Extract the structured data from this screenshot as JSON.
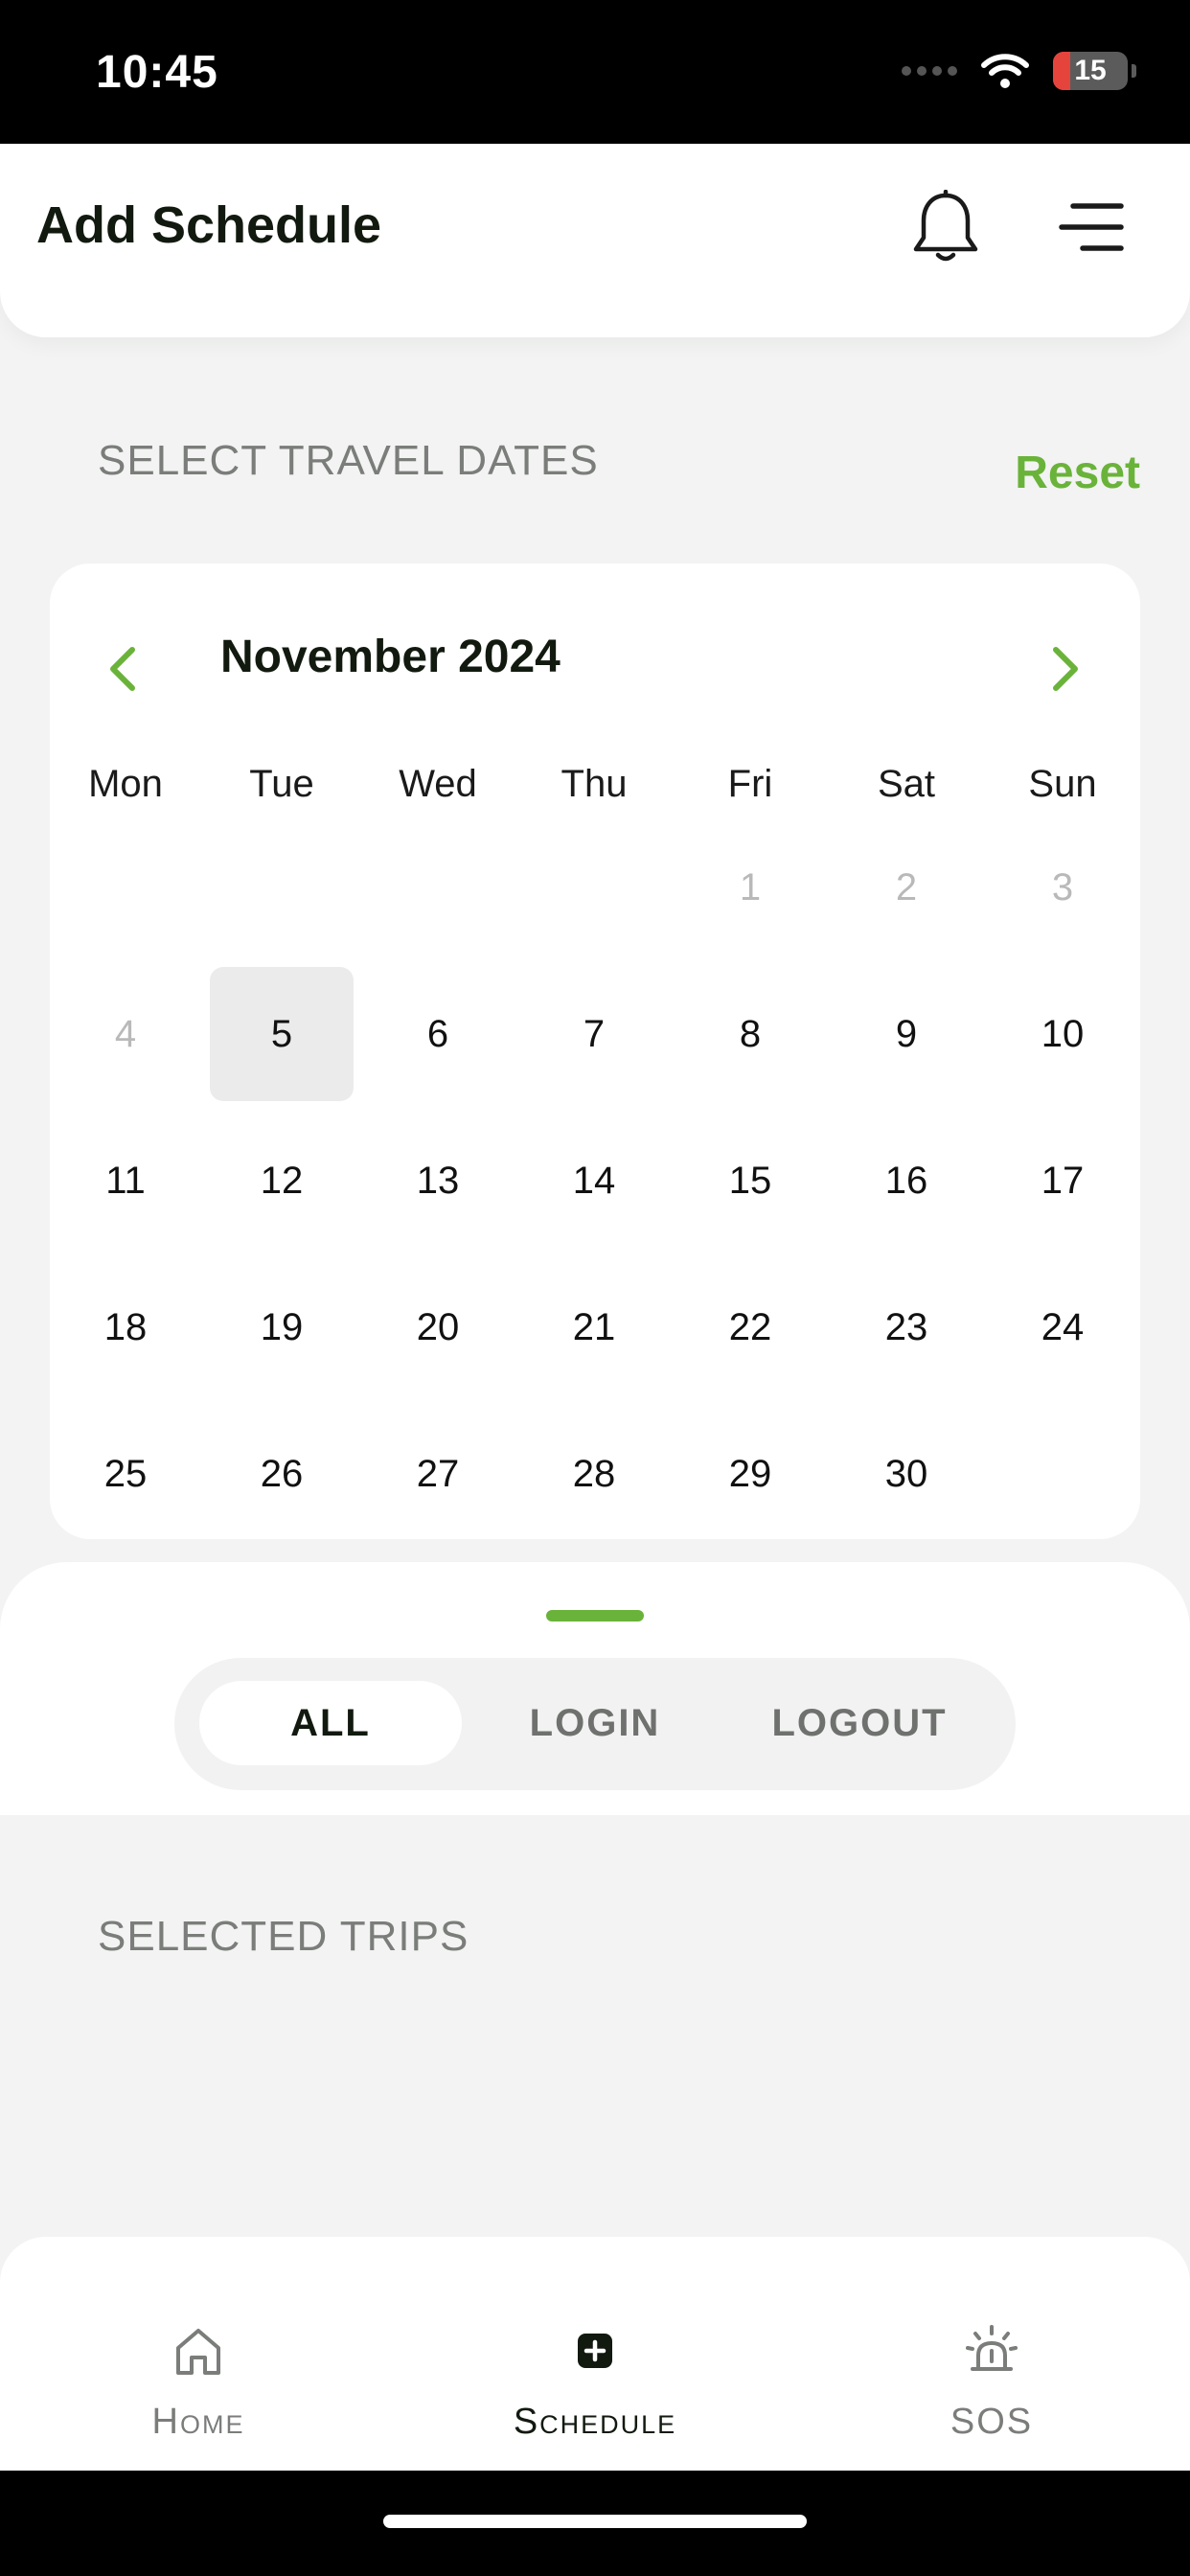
{
  "status_bar": {
    "time": "10:45",
    "battery": "15"
  },
  "header": {
    "title": "Add Schedule",
    "notifications_icon": "bell-icon",
    "menu_icon": "hamburger-menu-icon"
  },
  "travel_dates": {
    "label": "SELECT TRAVEL DATES",
    "reset_label": "Reset"
  },
  "calendar": {
    "month_label": "November 2024",
    "weekdays": [
      "Mon",
      "Tue",
      "Wed",
      "Thu",
      "Fri",
      "Sat",
      "Sun"
    ],
    "weeks": [
      [
        "",
        "",
        "",
        "",
        "1",
        "2",
        "3"
      ],
      [
        "4",
        "5",
        "6",
        "7",
        "8",
        "9",
        "10"
      ],
      [
        "11",
        "12",
        "13",
        "14",
        "15",
        "16",
        "17"
      ],
      [
        "18",
        "19",
        "20",
        "21",
        "22",
        "23",
        "24"
      ],
      [
        "25",
        "26",
        "27",
        "28",
        "29",
        "30",
        ""
      ]
    ],
    "disabled_days": [
      "1",
      "2",
      "3",
      "4"
    ],
    "highlighted_day": "5"
  },
  "filter_tabs": {
    "items": [
      "ALL",
      "LOGIN",
      "LOGOUT"
    ],
    "selected": "ALL"
  },
  "selected_trips": {
    "label": "SELECTED TRIPS"
  },
  "bottom_nav": {
    "items": [
      {
        "label": "Home",
        "icon": "home-icon"
      },
      {
        "label": "Schedule",
        "icon": "add-square-icon"
      },
      {
        "label": "SOS",
        "icon": "siren-icon"
      }
    ],
    "active": "Schedule"
  },
  "colors": {
    "accent": "#6ab33a",
    "background": "#f2f3f2",
    "text_dark": "#121a10",
    "muted": "#7a7d7a"
  }
}
